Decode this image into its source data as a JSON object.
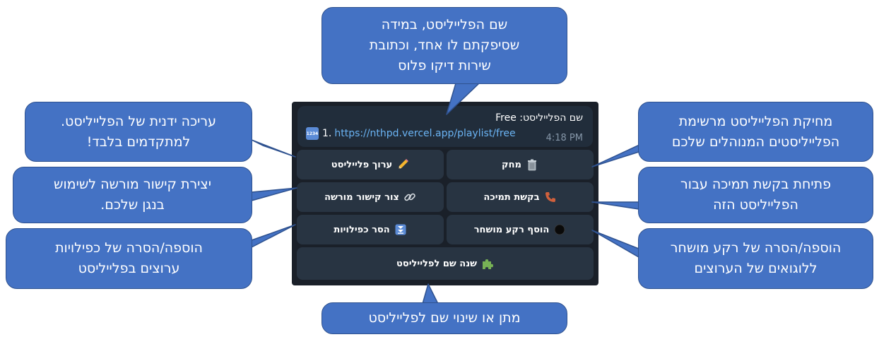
{
  "callouts": {
    "playlist_name": [
      "שם הפלייליסט, במידה",
      "שסיפקתם לו אחד, וכתובת",
      "שירות דיקו פלוס"
    ],
    "manual_edit": [
      "עריכה ידנית של הפלייליסט.",
      "למתקדמים בלבד!"
    ],
    "delete": [
      "מחיקת הפלייליסט מרשימת",
      "הפלייליסטים המנוהלים שלכם"
    ],
    "legacy_link": [
      "יצירת קישור מורשה לשימוש",
      "בנגן שלכם."
    ],
    "support": [
      "פתיחת בקשת תמיכה עבור",
      "הפלייליסט הזה"
    ],
    "duplicates": [
      "הוספה/הסרה של כפילויות",
      "ערוצים בפלייליסט"
    ],
    "dark_bg": [
      "הוספה/הסרה של רקע מושחר",
      "ללוגואים של הערוצים"
    ],
    "rename": [
      "מתן או שינוי שם לפלייליסט"
    ]
  },
  "message": {
    "title": "שם הפלייליסט: Free",
    "line_prefix": "1.",
    "link": "https://nthpd.vercel.app/playlist/free",
    "time": "4:18 PM",
    "numbers_icon_text": "1234"
  },
  "buttons": {
    "edit_playlist": {
      "label": "ערוך פלייליסט",
      "icon": "pencil-icon"
    },
    "delete": {
      "label": "מחק",
      "icon": "trash-icon"
    },
    "create_link": {
      "label": "צור קישור מורשה",
      "icon": "link-icon"
    },
    "support_request": {
      "label": "בקשת תמיכה",
      "icon": "phone-icon"
    },
    "remove_duplicates": {
      "label": "הסר כפילויות",
      "icon": "down-arrow-icon"
    },
    "add_dark_bg": {
      "label": "הוסף רקע מושחר",
      "icon": "black-circle-icon"
    },
    "rename_playlist": {
      "label": "שנה שם לפלייליסט",
      "icon": "puzzle-icon"
    }
  },
  "colors": {
    "callout_fill": "#4472c4",
    "callout_border": "#2f528f",
    "panel_bg": "#1a2029",
    "button_bg": "#283442",
    "link": "#6ab3f3"
  }
}
